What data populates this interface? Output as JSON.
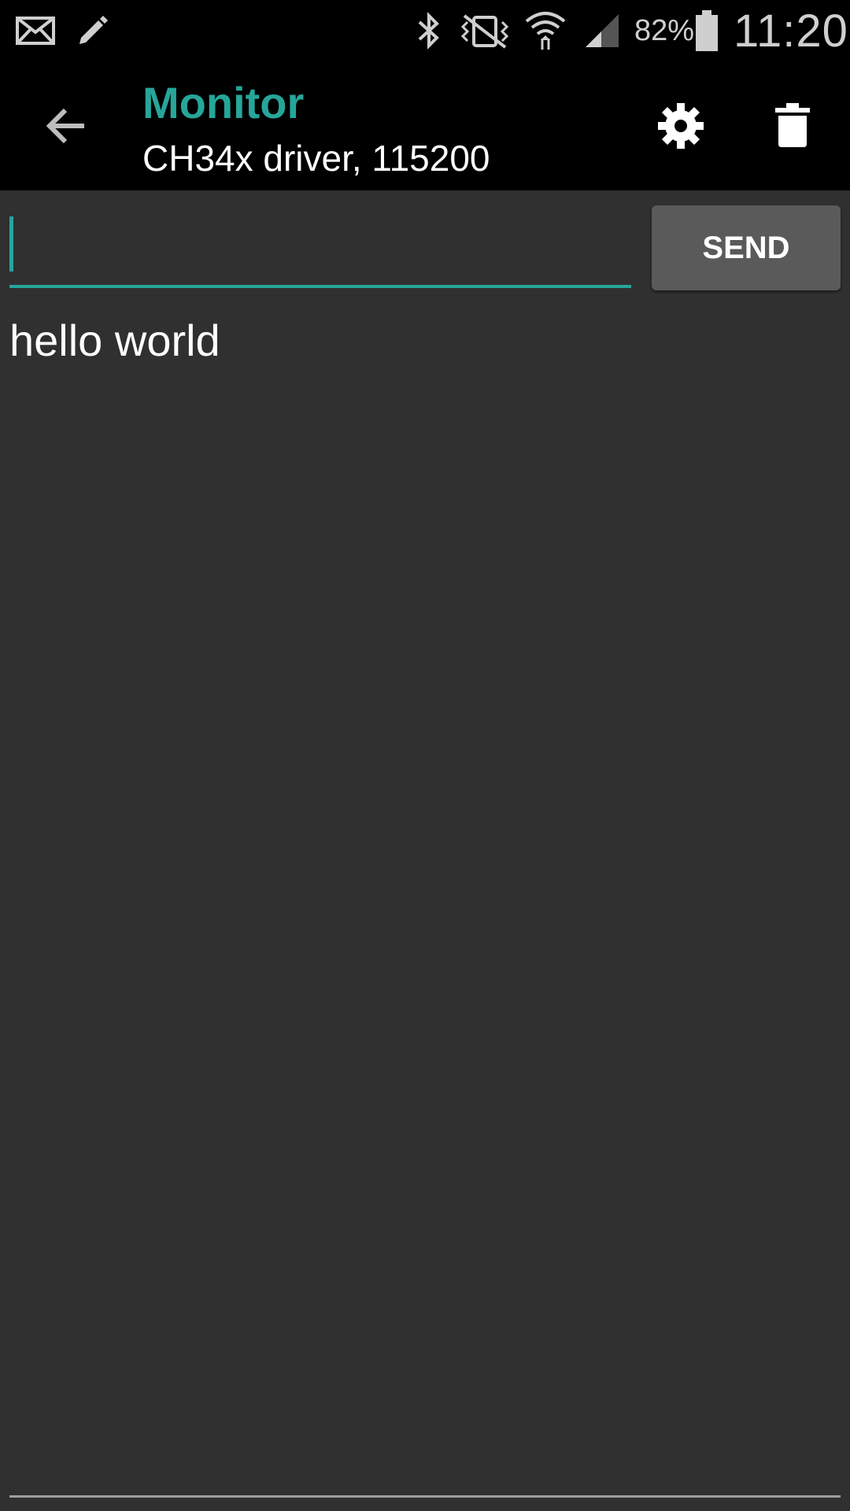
{
  "status_bar": {
    "icons": [
      "mail-icon",
      "pencil-icon",
      "bluetooth-icon",
      "vibrate-icon",
      "wifi-icon",
      "signal-icon",
      "battery-icon"
    ],
    "battery_percent": "82%",
    "time": "11:20"
  },
  "app_bar": {
    "title": "Monitor",
    "subtitle": "CH34x driver, 115200",
    "accent_color": "#26a69a",
    "icons": [
      "back-arrow-icon",
      "gear-icon",
      "trash-icon"
    ]
  },
  "send": {
    "input_value": "",
    "button_label": "SEND"
  },
  "receive": {
    "text": "hello world"
  }
}
